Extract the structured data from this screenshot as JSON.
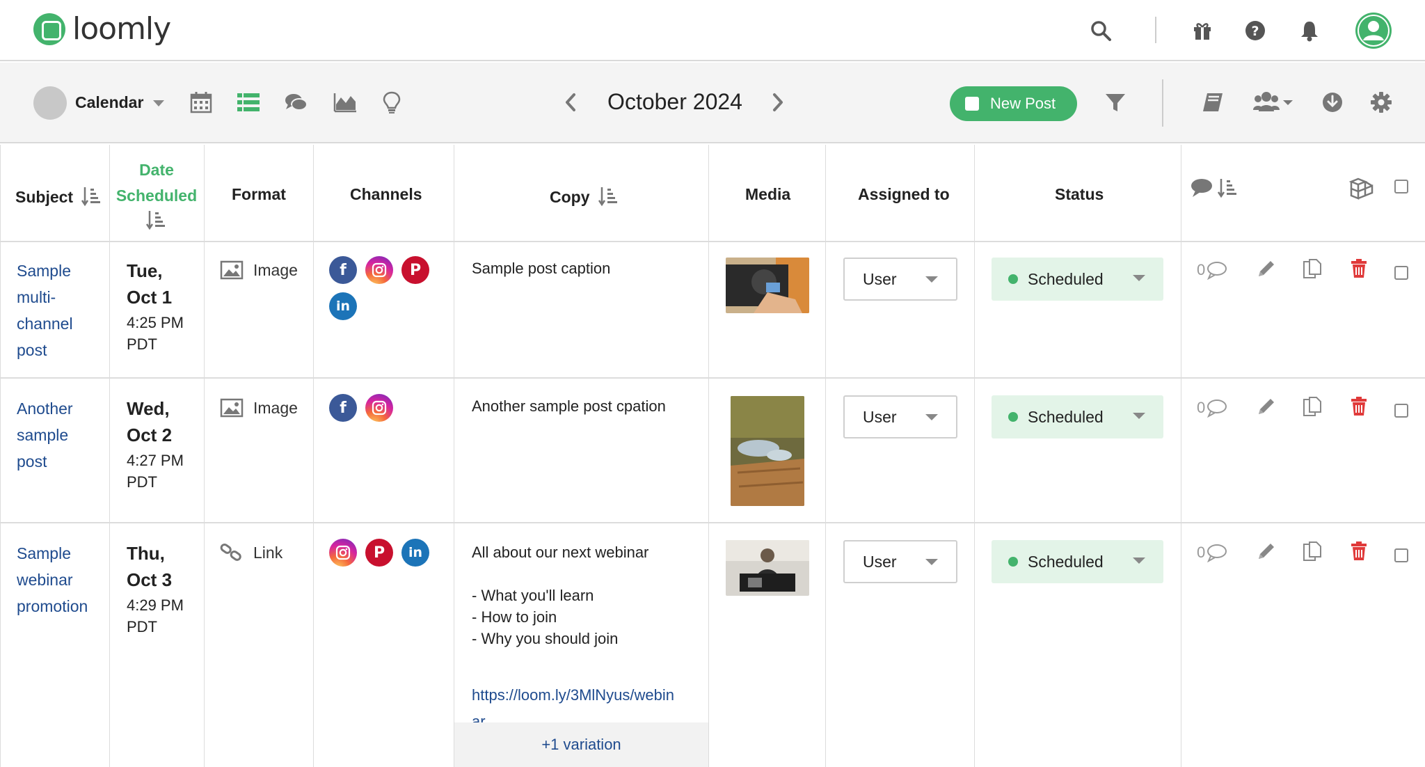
{
  "app": {
    "logo_text": "loomly"
  },
  "topbar": {
    "icons": [
      "search-icon",
      "gift-icon",
      "help-icon",
      "bell-icon",
      "user-avatar"
    ]
  },
  "toolbar": {
    "calendar_label": "Calendar",
    "month_label": "October 2024",
    "new_post_label": "New Post",
    "view_icons": [
      "calendar-grid-icon",
      "list-view-icon",
      "comments-icon",
      "analytics-icon",
      "ideas-icon"
    ],
    "right_icons": [
      "filter-icon",
      "library-icon",
      "team-icon",
      "download-icon",
      "settings-icon"
    ]
  },
  "table": {
    "headers": {
      "subject": "Subject",
      "date_line1": "Date",
      "date_line2": "Scheduled",
      "format": "Format",
      "channels": "Channels",
      "copy": "Copy",
      "media": "Media",
      "assigned": "Assigned to",
      "status": "Status"
    },
    "rows": [
      {
        "subject_lines": [
          "Sample",
          "multi-",
          "channel",
          "post"
        ],
        "day_line1": "Tue,",
        "day_line2": "Oct 1",
        "time_line1": "4:25 PM",
        "time_line2": "PDT",
        "format": "Image",
        "channels": [
          "facebook",
          "instagram",
          "pinterest",
          "linkedin"
        ],
        "copy_lines": [
          "Sample post caption"
        ],
        "assigned": "User",
        "status": "Scheduled",
        "comments": "0"
      },
      {
        "subject_lines": [
          "Another",
          "sample",
          "post"
        ],
        "day_line1": "Wed,",
        "day_line2": "Oct 2",
        "time_line1": "4:27 PM",
        "time_line2": "PDT",
        "format": "Image",
        "channels": [
          "facebook",
          "instagram"
        ],
        "copy_lines": [
          "Another sample post cpation"
        ],
        "assigned": "User",
        "status": "Scheduled",
        "comments": "0"
      },
      {
        "subject_lines": [
          "Sample",
          "webinar",
          "promotion"
        ],
        "day_line1": "Thu,",
        "day_line2": "Oct 3",
        "time_line1": "4:29 PM",
        "time_line2": "PDT",
        "format": "Link",
        "channels": [
          "instagram",
          "pinterest",
          "linkedin"
        ],
        "copy_lines": [
          "All about our next webinar",
          "",
          "- What you'll learn",
          "- How to join",
          "- Why you should join"
        ],
        "copy_link_line1": "https://loom.ly/3MlNyus/webin",
        "copy_link_line2": "ar",
        "variation": "+1 variation",
        "assigned": "User",
        "status": "Scheduled",
        "comments": "0"
      }
    ]
  },
  "colors": {
    "brand_green": "#43b36c",
    "link_blue": "#1f4b8e",
    "status_bg": "#e3f4e8",
    "delete_red": "#e03a3a"
  }
}
